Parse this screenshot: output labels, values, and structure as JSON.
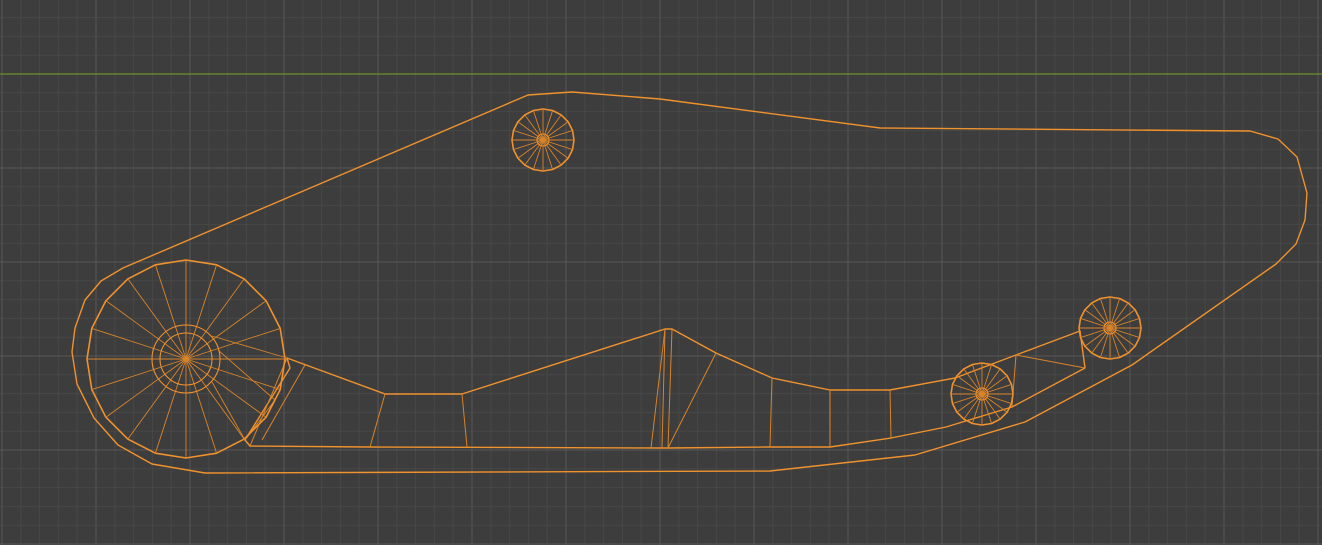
{
  "viewport": {
    "view": "orthographic-top",
    "mode": "edit-mode-wireframe"
  },
  "colors": {
    "background": "#3d3d3d",
    "grid_minor": "#474747",
    "grid_major": "#565656",
    "axis_x": "#6e8f2e",
    "wire": "#f0922e",
    "wire_inner": "#d8842a"
  },
  "objects": [
    {
      "name": "outer-outline",
      "selected": true
    },
    {
      "name": "inner-outline",
      "selected": true
    },
    {
      "name": "hub-large-left",
      "selected": true
    },
    {
      "name": "hub-small-top",
      "selected": true
    },
    {
      "name": "hub-small-right-lower",
      "selected": true
    },
    {
      "name": "hub-small-right-upper",
      "selected": true
    }
  ]
}
